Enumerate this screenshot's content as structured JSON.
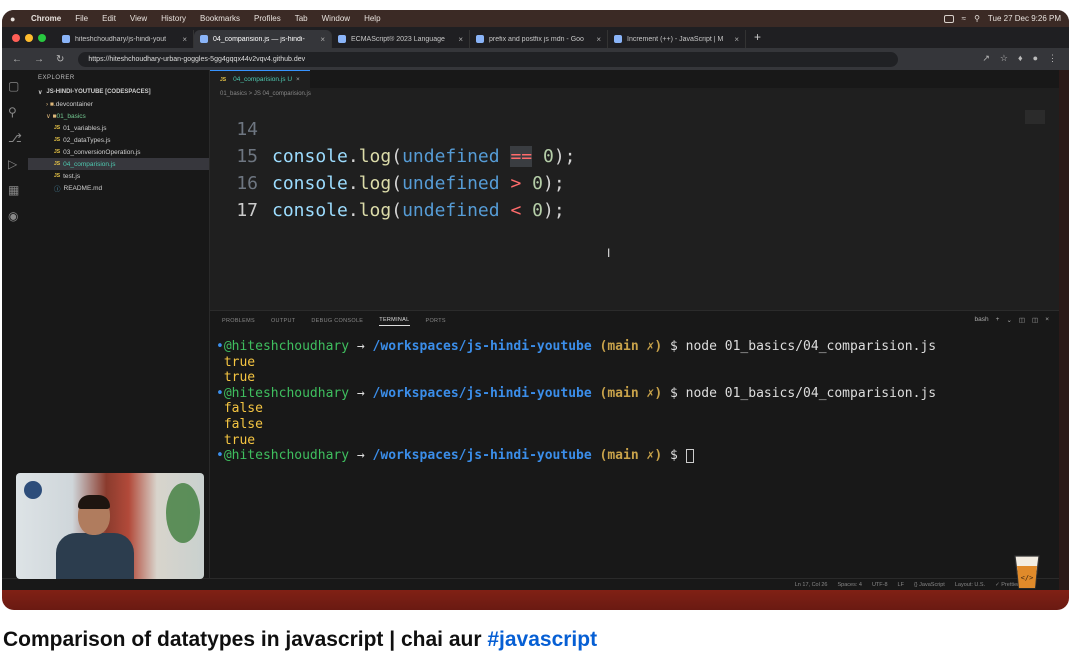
{
  "mac_menu": {
    "apple": "",
    "items": [
      "Chrome",
      "File",
      "Edit",
      "View",
      "History",
      "Bookmarks",
      "Profiles",
      "Tab",
      "Window",
      "Help"
    ],
    "datetime": "Tue 27 Dec 9:26 PM"
  },
  "browser": {
    "tabs": [
      {
        "label": "hiteshchoudhary/js-hindi-yout"
      },
      {
        "label": "04_comparision.js — js-hindi-"
      },
      {
        "label": "ECMAScript® 2023 Language"
      },
      {
        "label": "prefix and postfix js mdn - Goo"
      },
      {
        "label": "Increment (++) - JavaScript | M"
      }
    ],
    "active_tab": 1,
    "url": "https://hiteshchoudhary-urban-goggles-5gg4gqqx44v2vqv4.github.dev"
  },
  "explorer": {
    "header": "EXPLORER",
    "workspace": "JS-HINDI-YOUTUBE [CODESPACES]",
    "items": [
      {
        "label": ".devcontainer",
        "type": "folder"
      },
      {
        "label": "01_basics",
        "type": "folder-open"
      },
      {
        "label": "01_variables.js",
        "type": "js"
      },
      {
        "label": "02_dataTypes.js",
        "type": "js"
      },
      {
        "label": "03_conversionOperation.js",
        "type": "js"
      },
      {
        "label": "04_comparision.js",
        "type": "js",
        "selected": true
      },
      {
        "label": "test.js",
        "type": "js"
      },
      {
        "label": "README.md",
        "type": "md"
      }
    ]
  },
  "editor": {
    "tab_label": "04_comparision.js U",
    "breadcrumb": "01_basics > JS 04_comparision.js",
    "lines": [
      {
        "num": "14",
        "code": ""
      },
      {
        "num": "15",
        "obj": "console",
        "fn": "log",
        "arg": "undefined",
        "op": "==",
        "val": "0"
      },
      {
        "num": "16",
        "obj": "console",
        "fn": "log",
        "arg": "undefined",
        "op": ">",
        "val": "0"
      },
      {
        "num": "17",
        "obj": "console",
        "fn": "log",
        "arg": "undefined",
        "op": "<",
        "val": "0"
      }
    ]
  },
  "panel": {
    "tabs": [
      "PROBLEMS",
      "OUTPUT",
      "DEBUG CONSOLE",
      "TERMINAL",
      "PORTS"
    ],
    "active_tab": "TERMINAL",
    "shell": "bash"
  },
  "terminal": {
    "user": "@hiteshchoudhary",
    "path": "/workspaces/js-hindi-youtube",
    "branch": "main",
    "command": "node 01_basics/04_comparision.js",
    "runs": [
      {
        "output": [
          "true",
          "true"
        ]
      },
      {
        "output": [
          "false",
          "false",
          "true"
        ]
      }
    ]
  },
  "status_bar": {
    "items": [
      "Ln 17, Col 26",
      "Spaces: 4",
      "UTF-8",
      "LF",
      "{} JavaScript",
      "Layout: U.S.",
      "✓ Prettier"
    ]
  },
  "video_title": {
    "text": "Comparison of datatypes in javascript | chai aur ",
    "hashtag": "#javascript"
  },
  "colors": {
    "terminal_output": "#f5c542",
    "prompt_user": "#3fbf5f",
    "prompt_path": "#3b8eea",
    "hashtag": "#065fd4"
  }
}
